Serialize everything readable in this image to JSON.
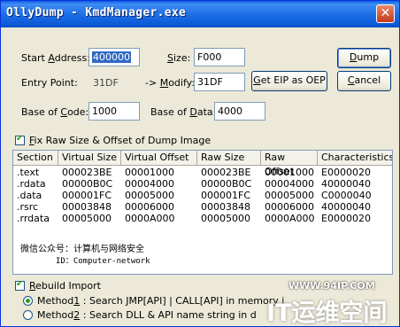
{
  "window": {
    "title": "OllyDump - KmdManager.exe",
    "close_glyph": "✕"
  },
  "fields": {
    "start_address": {
      "label_pre": "Start ",
      "label_u": "A",
      "label_post": "ddress:",
      "value": "400000"
    },
    "size": {
      "label_pre": "",
      "label_u": "S",
      "label_post": "ize:",
      "value": "F000"
    },
    "entry_point": {
      "label": "Entry Point:",
      "value": "31DF"
    },
    "modify": {
      "label_pre": "-> ",
      "label_u": "M",
      "label_post": "odify:",
      "value": "31DF"
    },
    "base_of_code": {
      "label_pre": "Base of ",
      "label_u": "C",
      "label_post": "ode:",
      "value": "1000"
    },
    "base_of_data": {
      "label_pre": "Base of ",
      "label_u": "D",
      "label_post": "ata:",
      "value": "4000"
    }
  },
  "buttons": {
    "dump": {
      "pre": "",
      "u": "D",
      "post": "ump"
    },
    "cancel": {
      "pre": "",
      "u": "C",
      "post": "ancel"
    },
    "get_eip": {
      "pre": "",
      "u": "G",
      "post": "et EIP as OEP"
    }
  },
  "fix_raw": {
    "pre": "",
    "u": "F",
    "post": "ix Raw Size & Offset of Dump Image",
    "checked": true
  },
  "table": {
    "columns": [
      "Section",
      "Virtual Size",
      "Virtual Offset",
      "Raw Size",
      "Raw Offset",
      "Characteristics"
    ],
    "rows": [
      [
        ".text",
        "000023BE",
        "00001000",
        "000023BE",
        "00001000",
        "E0000020"
      ],
      [
        ".rdata",
        "00000B0C",
        "00004000",
        "00000B0C",
        "00004000",
        "40000040"
      ],
      [
        ".data",
        "000001FC",
        "00005000",
        "000001FC",
        "00005000",
        "C0000040"
      ],
      [
        ".rsrc",
        "00003848",
        "00006000",
        "00003848",
        "00006000",
        "40000040"
      ],
      [
        ".rrdata",
        "00005000",
        "0000A000",
        "00005000",
        "0000A000",
        "E0000020"
      ]
    ]
  },
  "watermark": {
    "line1": "微信公众号：计算机与网络安全",
    "line2": "ID：Computer-network"
  },
  "rebuild_import": {
    "pre": "",
    "u": "R",
    "post": "ebuild Import",
    "checked": true
  },
  "methods": [
    {
      "pre": "Method",
      "u": "1",
      "post": " : Search JMP[API] | CALL[API] in memory i",
      "selected": true
    },
    {
      "pre": "Method",
      "u": "2",
      "post": " : Search DLL & API name string in d",
      "selected": false
    }
  ],
  "brand": {
    "url": "WWW.94IP.COM",
    "name": "IT运维空间"
  }
}
